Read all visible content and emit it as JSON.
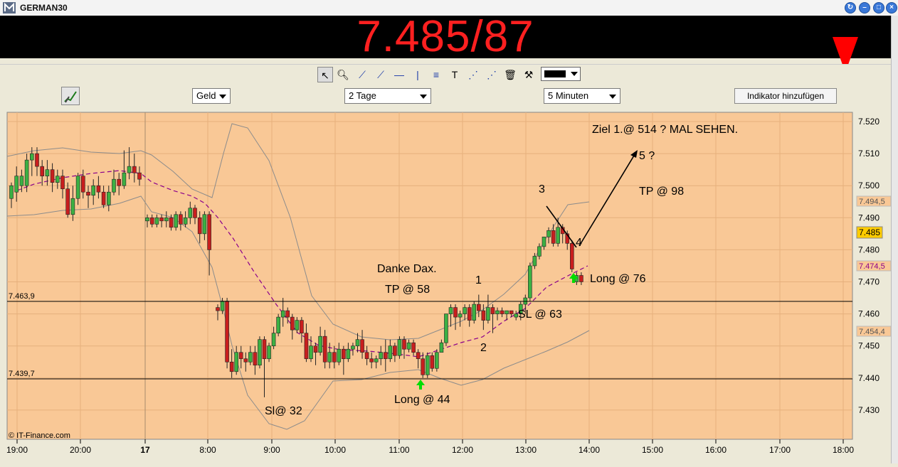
{
  "window": {
    "title": "GERMAN30"
  },
  "quote": {
    "value": "7.485/87",
    "direction_icon": "red-down-arrow-icon",
    "color": "#ff2020"
  },
  "toolbar": {
    "tools": [
      "pointer-icon",
      "zoom-icon",
      "trendline-icon",
      "ray-icon",
      "horizontal-line-icon",
      "vertical-line-icon",
      "fibonacci-icon",
      "text-icon",
      "channel-icon",
      "parallel-icon",
      "trash-icon",
      "tools-icon"
    ],
    "color_value": "#000000"
  },
  "controls": {
    "price_type": "Geld",
    "period": "2 Tage",
    "interval": "5 Minuten",
    "add_indicator": "Indikator hinzufügen"
  },
  "chart_data": {
    "type": "candlestick",
    "background": "#f9c896",
    "y_ticks": [
      "7.520",
      "7.510",
      "7.500",
      "7.490",
      "7.480",
      "7.470",
      "7.460",
      "7.450",
      "7.440",
      "7.430"
    ],
    "ylim": [
      7422,
      7523
    ],
    "x_ticks": [
      "19:00",
      "20:00",
      "17",
      "8:00",
      "9:00",
      "10:00",
      "11:00",
      "12:00",
      "13:00",
      "14:00",
      "15:00",
      "16:00",
      "17:00",
      "18:00"
    ],
    "price_labels": {
      "upper_band": "7.494,5",
      "last": "7.485",
      "middle": "7.474,5",
      "lower_band": "7.454,4"
    },
    "horizontal_lines": [
      {
        "label": "7.463,9",
        "value": 7463.9
      },
      {
        "label": "7.439,7",
        "value": 7439.7
      }
    ],
    "annotations": {
      "target": "Ziel 1.@ 514 ? MAL SEHEN.",
      "wave5": "5 ?",
      "tp98": "TP @ 98",
      "wave3": "3",
      "wave4": "4",
      "long76": "Long @ 76",
      "danke": "Danke Dax.",
      "tp58": "TP @ 58",
      "wave1": "1",
      "sl63": "SL @ 63",
      "wave2": "2",
      "long44": "Long @ 44",
      "sl32": "Sl@ 32"
    },
    "copyright": "© IT-Finance.com",
    "candles": [
      [
        7496,
        7500,
        7493,
        7501
      ],
      [
        7498,
        7503,
        7495,
        7506
      ],
      [
        7500,
        7503,
        7498,
        7505
      ],
      [
        7500,
        7508,
        7498,
        7510
      ],
      [
        7508,
        7510,
        7503,
        7512
      ],
      [
        7510,
        7506,
        7503,
        7512
      ],
      [
        7506,
        7503,
        7500,
        7508
      ],
      [
        7503,
        7505,
        7500,
        7508
      ],
      [
        7505,
        7501,
        7498,
        7507
      ],
      [
        7501,
        7503,
        7499,
        7505
      ],
      [
        7503,
        7499,
        7496,
        7505
      ],
      [
        7499,
        7491,
        7490,
        7501
      ],
      [
        7491,
        7496,
        7489,
        7500
      ],
      [
        7496,
        7503,
        7494,
        7504
      ],
      [
        7503,
        7498,
        7496,
        7505
      ],
      [
        7498,
        7497,
        7493,
        7500
      ],
      [
        7497,
        7500,
        7494,
        7502
      ],
      [
        7500,
        7498,
        7496,
        7503
      ],
      [
        7498,
        7494,
        7493,
        7500
      ],
      [
        7494,
        7498,
        7492,
        7500
      ],
      [
        7498,
        7502,
        7497,
        7505
      ],
      [
        7502,
        7500,
        7497,
        7504
      ],
      [
        7500,
        7504,
        7499,
        7511
      ],
      [
        7504,
        7506,
        7502,
        7512
      ],
      [
        7506,
        7504,
        7501,
        7510
      ],
      [
        7504,
        7502,
        7500,
        7506
      ],
      [
        7489,
        7490,
        7487,
        7491
      ],
      [
        7490,
        7488,
        7487,
        7491
      ],
      [
        7488,
        7490,
        7487,
        7491
      ],
      [
        7490,
        7489,
        7487,
        7491
      ],
      [
        7489,
        7490,
        7487,
        7492
      ],
      [
        7490,
        7487,
        7486,
        7491
      ],
      [
        7487,
        7491,
        7486,
        7492
      ],
      [
        7491,
        7488,
        7486,
        7492
      ],
      [
        7488,
        7490,
        7487,
        7492
      ],
      [
        7490,
        7493,
        7488,
        7495
      ],
      [
        7493,
        7490,
        7488,
        7494
      ],
      [
        7490,
        7485,
        7482,
        7492
      ],
      [
        7485,
        7491,
        7483,
        7492
      ],
      [
        7491,
        7480,
        7472,
        7492
      ],
      [
        7462,
        7461,
        7458,
        7463
      ],
      [
        7461,
        7464,
        7460,
        7465
      ],
      [
        7464,
        7445,
        7443,
        7465
      ],
      [
        7445,
        7442,
        7440,
        7449
      ],
      [
        7442,
        7448,
        7441,
        7450
      ],
      [
        7448,
        7446,
        7443,
        7450
      ],
      [
        7446,
        7445,
        7442,
        7448
      ],
      [
        7445,
        7448,
        7444,
        7450
      ],
      [
        7448,
        7444,
        7441,
        7450
      ],
      [
        7444,
        7452,
        7443,
        7453
      ],
      [
        7452,
        7446,
        7434,
        7453
      ],
      [
        7446,
        7450,
        7445,
        7451
      ],
      [
        7450,
        7454,
        7449,
        7456
      ],
      [
        7454,
        7459,
        7453,
        7460
      ],
      [
        7459,
        7461,
        7456,
        7465
      ],
      [
        7461,
        7459,
        7457,
        7462
      ],
      [
        7459,
        7455,
        7452,
        7460
      ],
      [
        7455,
        7458,
        7454,
        7459
      ],
      [
        7458,
        7454,
        7451,
        7459
      ],
      [
        7454,
        7446,
        7445,
        7457
      ],
      [
        7446,
        7450,
        7445,
        7453
      ],
      [
        7450,
        7448,
        7444,
        7451
      ],
      [
        7448,
        7453,
        7447,
        7456
      ],
      [
        7453,
        7445,
        7443,
        7455
      ],
      [
        7445,
        7448,
        7443,
        7451
      ],
      [
        7448,
        7445,
        7443,
        7450
      ],
      [
        7445,
        7449,
        7444,
        7451
      ],
      [
        7449,
        7446,
        7441,
        7450
      ],
      [
        7446,
        7449,
        7445,
        7451
      ],
      [
        7449,
        7450,
        7447,
        7451
      ],
      [
        7450,
        7452,
        7448,
        7454
      ],
      [
        7452,
        7448,
        7446,
        7455
      ],
      [
        7448,
        7446,
        7444,
        7450
      ],
      [
        7446,
        7445,
        7443,
        7448
      ],
      [
        7445,
        7446,
        7443,
        7447
      ],
      [
        7446,
        7448,
        7444,
        7450
      ],
      [
        7448,
        7446,
        7442,
        7452
      ],
      [
        7446,
        7450,
        7445,
        7452
      ],
      [
        7450,
        7447,
        7445,
        7451
      ],
      [
        7447,
        7452,
        7446,
        7453
      ],
      [
        7452,
        7449,
        7446,
        7453
      ],
      [
        7449,
        7451,
        7448,
        7452
      ],
      [
        7451,
        7448,
        7447,
        7452
      ],
      [
        7448,
        7446,
        7443,
        7449
      ],
      [
        7446,
        7441,
        7440,
        7448
      ],
      [
        7441,
        7447,
        7440,
        7448
      ],
      [
        7447,
        7443,
        7442,
        7448
      ],
      [
        7443,
        7448,
        7442,
        7449
      ],
      [
        7448,
        7451,
        7448,
        7452
      ],
      [
        7451,
        7460,
        7450,
        7460
      ],
      [
        7460,
        7462,
        7456,
        7463
      ],
      [
        7462,
        7459,
        7455,
        7463
      ],
      [
        7459,
        7460,
        7456,
        7461
      ],
      [
        7460,
        7462,
        7458,
        7463
      ],
      [
        7462,
        7458,
        7456,
        7463
      ],
      [
        7458,
        7463,
        7457,
        7464
      ],
      [
        7463,
        7461,
        7459,
        7466
      ],
      [
        7461,
        7458,
        7455,
        7463
      ],
      [
        7458,
        7462,
        7457,
        7466
      ],
      [
        7462,
        7460,
        7454,
        7463
      ],
      [
        7460,
        7461,
        7458,
        7462
      ],
      [
        7461,
        7460,
        7459,
        7462
      ],
      [
        7460,
        7461,
        7458,
        7461
      ],
      [
        7461,
        7460,
        7459,
        7461
      ],
      [
        7459,
        7460,
        7458,
        7461
      ],
      [
        7460,
        7463,
        7458,
        7464
      ],
      [
        7463,
        7465,
        7460,
        7466
      ],
      [
        7465,
        7475,
        7464,
        7476
      ],
      [
        7475,
        7478,
        7474,
        7479
      ],
      [
        7478,
        7481,
        7477,
        7482
      ],
      [
        7481,
        7484,
        7480,
        7484
      ],
      [
        7484,
        7486,
        7482,
        7487
      ],
      [
        7486,
        7482,
        7481,
        7488
      ],
      [
        7482,
        7487,
        7481,
        7490
      ],
      [
        7487,
        7485,
        7482,
        7488
      ],
      [
        7485,
        7482,
        7480,
        7486
      ],
      [
        7482,
        7474,
        7473,
        7483
      ],
      [
        7470,
        7472,
        7469,
        7473
      ],
      [
        7472,
        7470,
        7469,
        7473
      ],
      [
        7470,
        7475,
        7470,
        7476
      ],
      [
        7475,
        7483,
        7475,
        7484
      ],
      [
        7483,
        7479,
        7478,
        7484
      ],
      [
        7479,
        7485,
        7478,
        7486
      ],
      [
        7485,
        7485,
        7484,
        7486
      ]
    ]
  }
}
